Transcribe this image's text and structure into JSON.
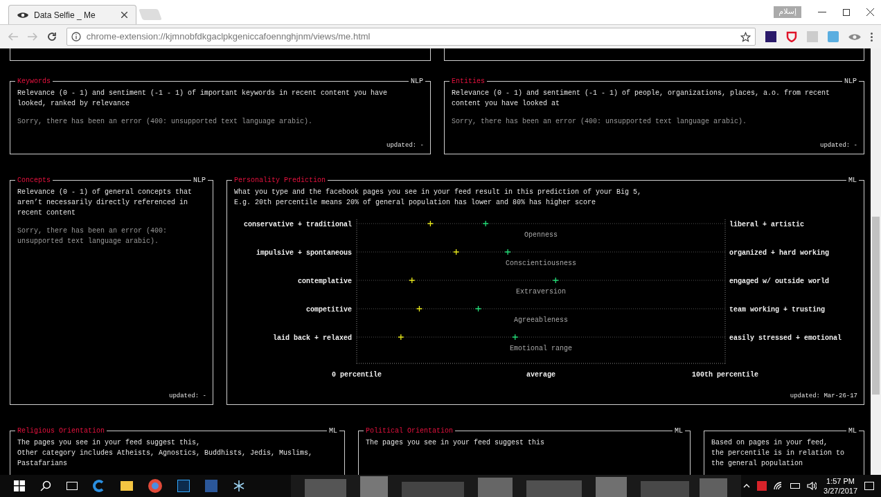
{
  "browser": {
    "tab_title": "Data Selfie _ Me",
    "profile_button": "إسلام",
    "address": "chrome-extension://kjmnobfdkgaclpkgeniccafoennghjnm/views/me.html"
  },
  "top_panels": [
    {
      "title": "Keywords",
      "tag": "NLP",
      "description": [
        "Relevance (0 - 1) and sentiment (-1 - 1) of important keywords in recent content you have",
        "looked, ranked by relevance"
      ],
      "error": [
        "Sorry, there has been an error (400: unsupported text language arabic)."
      ],
      "updated": "updated: -"
    },
    {
      "title": "Entities",
      "tag": "NLP",
      "description": [
        "Relevance (0 - 1) and sentiment (-1 - 1) of people, organizations, places, a.o. from recent",
        "content you have looked at"
      ],
      "error": [
        "Sorry, there has been an error (400: unsupported text language arabic)."
      ],
      "updated": "updated: -"
    }
  ],
  "concepts": {
    "title": "Concepts",
    "tag": "NLP",
    "description": [
      "Relevance (0 - 1) of general concepts that",
      "aren’t necessarily directly referenced in",
      "recent content"
    ],
    "error": [
      "Sorry, there has been an error (400:",
      "unsupported text language arabic)."
    ],
    "updated": "updated: -"
  },
  "personality": {
    "title": "Personality Prediction",
    "tag": "ML",
    "description": [
      "What you type and the facebook pages you see in your feed result in this prediction of your Big 5,",
      "E.g. 20th percentile means 20% of general population has lower and 80% has higher score"
    ],
    "poles": [
      {
        "low": "conservative + traditional",
        "high": "liberal + artistic"
      },
      {
        "low": "impulsive + spontaneous",
        "high": "organized + hard working"
      },
      {
        "low": "contemplative",
        "high": "engaged w/ outside world"
      },
      {
        "low": "competitive",
        "high": "team working + trusting"
      },
      {
        "low": "laid back + relaxed",
        "high": "easily stressed + emotional"
      }
    ],
    "chart_data": {
      "type": "scatter",
      "orientation": "horizontal",
      "categories": [
        "Openness",
        "Conscientiousness",
        "Extraversion",
        "Agreeableness",
        "Emotional range"
      ],
      "series": [
        {
          "color": "#e8e81a",
          "values": [
            20,
            27,
            15,
            17,
            12
          ]
        },
        {
          "color": "#22dd77",
          "values": [
            35,
            41,
            54,
            33,
            43
          ]
        }
      ],
      "xlim": [
        0,
        100
      ],
      "xticks": [
        {
          "value": 0,
          "label": "0 percentile"
        },
        {
          "value": 50,
          "label": "average"
        },
        {
          "value": 100,
          "label": "100th percentile"
        }
      ]
    },
    "updated": "updated: Mar-26-17"
  },
  "bottom_panels": [
    {
      "title": "Religious Orientation",
      "tag": "ML",
      "description": [
        "The pages you see in your feed suggest this,",
        "Other category includes Atheists, Agnostics, Buddhists, Jedis, Muslims,",
        "Pastafarians"
      ]
    },
    {
      "title": "Political Orientation",
      "tag": "ML",
      "description": [
        "The pages you see in your feed suggest this"
      ]
    },
    {
      "tag": "ML",
      "description": [
        "Based on pages in your feed,",
        "the percentile is in relation to",
        "the general population"
      ]
    }
  ],
  "taskbar": {
    "time": "1:57 PM",
    "date": "3/27/2017"
  }
}
